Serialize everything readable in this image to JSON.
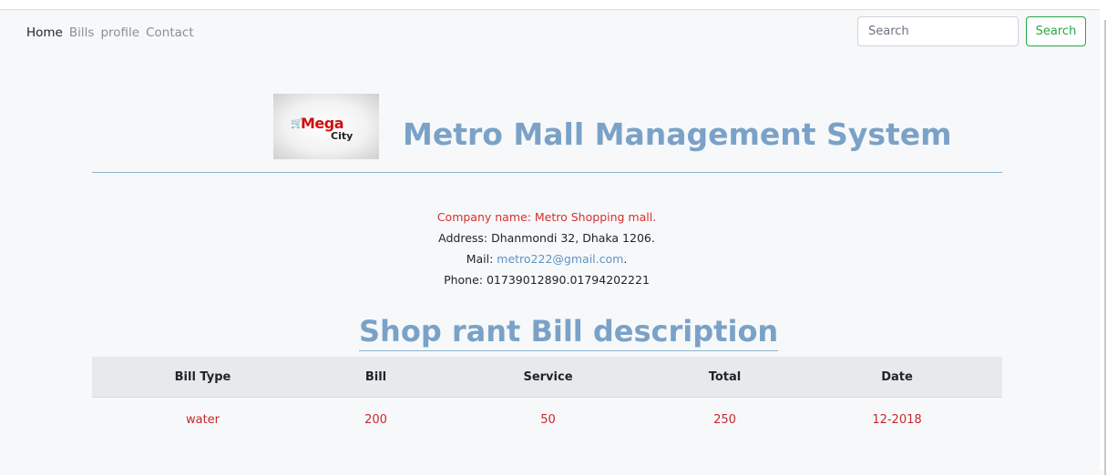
{
  "nav": {
    "items": [
      {
        "label": "Home",
        "active": true
      },
      {
        "label": "Bills",
        "active": false
      },
      {
        "label": "profile",
        "active": false
      },
      {
        "label": "Contact",
        "active": false
      }
    ],
    "search_placeholder": "Search",
    "search_button": "Search"
  },
  "logo": {
    "mega": "Mega",
    "city": "City"
  },
  "header": {
    "title": "Metro Mall Management System"
  },
  "company": {
    "name_line": "Company name: Metro Shopping mall.",
    "address_line": "Address: Dhanmondi 32, Dhaka 1206.",
    "mail_prefix": "Mail: ",
    "mail": "metro222@gmail.com",
    "mail_suffix": ".",
    "phone_line": "Phone: 01739012890.01794202221"
  },
  "bill": {
    "section_title": "Shop rant Bill description",
    "columns": [
      "Bill Type",
      "Bill",
      "Service",
      "Total",
      "Date"
    ],
    "rows": [
      [
        "water",
        "200",
        "50",
        "250",
        "12-2018"
      ]
    ]
  },
  "colors": {
    "accent": "#7aa2c8",
    "success": "#28a745",
    "danger_text": "#c8282d"
  }
}
